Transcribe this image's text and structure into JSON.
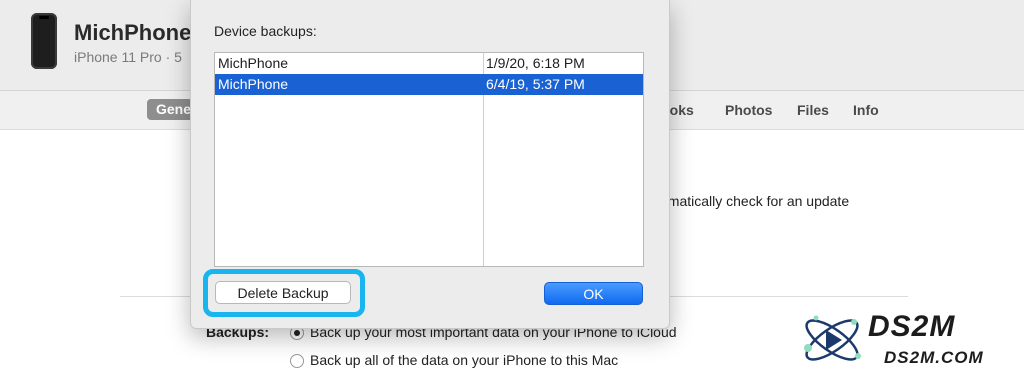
{
  "device": {
    "name": "MichPhone",
    "subtitle": "iPhone 11 Pro · 5"
  },
  "tabs": {
    "general": "Gene",
    "books": "Books",
    "photos": "Photos",
    "files": "Files",
    "info": "Info"
  },
  "content": {
    "update_text": "omatically check for an update",
    "backups_label": "Backups:",
    "option_icloud": "Back up your most important data on your iPhone to iCloud",
    "option_mac": "Back up all of the data on your iPhone to this Mac"
  },
  "dialog": {
    "title": "Device backups:",
    "backups": [
      {
        "name": "MichPhone",
        "date": "1/9/20, 6:18 PM",
        "selected": false
      },
      {
        "name": "MichPhone",
        "date": "6/4/19, 5:37 PM",
        "selected": true
      }
    ],
    "delete_label": "Delete Backup",
    "ok_label": "OK"
  },
  "watermark": {
    "title": "DS2M",
    "subtitle": "DS2M.COM"
  },
  "colors": {
    "selection": "#1a62d4",
    "ok_button": "#0f6bf0",
    "highlight": "#19b5ef"
  }
}
